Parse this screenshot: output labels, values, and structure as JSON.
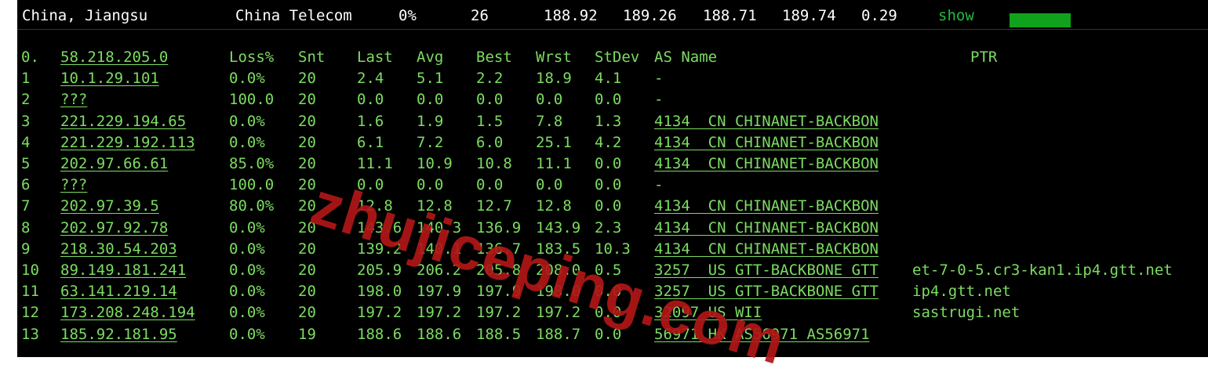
{
  "summary": {
    "location": "China, Jiangsu",
    "isp": "China Telecom",
    "loss": "0%",
    "sent": "26",
    "last": "188.92",
    "avg": "189.26",
    "best": "188.71",
    "worst": "189.74",
    "stdev": "0.29",
    "show_label": "show",
    "colors": {
      "show_link": "#1fbd3c",
      "bar": "#10a21c"
    }
  },
  "table": {
    "header": {
      "host": "0.",
      "target": "58.218.205.0",
      "loss": "Loss%",
      "snt": "Snt",
      "last": "Last",
      "avg": "Avg",
      "best": "Best",
      "wrst": "Wrst",
      "stdev": "StDev",
      "asname": "AS Name",
      "ptr": "PTR"
    },
    "rows": [
      {
        "hop": "1",
        "ip": "10.1.29.101",
        "loss": "0.0%",
        "snt": "20",
        "last": "2.4",
        "avg": "5.1",
        "best": "2.2",
        "wrst": "18.9",
        "stdev": "4.1",
        "as": "-",
        "ptr": ""
      },
      {
        "hop": "2",
        "ip": "???",
        "loss": "100.0",
        "snt": "20",
        "last": "0.0",
        "avg": "0.0",
        "best": "0.0",
        "wrst": "0.0",
        "stdev": "0.0",
        "as": "-",
        "ptr": ""
      },
      {
        "hop": "3",
        "ip": "221.229.194.65",
        "loss": "0.0%",
        "snt": "20",
        "last": "1.6",
        "avg": "1.9",
        "best": "1.5",
        "wrst": "7.8",
        "stdev": "1.3",
        "as": "4134  CN CHINANET-BACKBON",
        "ptr": ""
      },
      {
        "hop": "4",
        "ip": "221.229.192.113",
        "loss": "0.0%",
        "snt": "20",
        "last": "6.1",
        "avg": "7.2",
        "best": "6.0",
        "wrst": "25.1",
        "stdev": "4.2",
        "as": "4134  CN CHINANET-BACKBON",
        "ptr": ""
      },
      {
        "hop": "5",
        "ip": "202.97.66.61",
        "loss": "85.0%",
        "snt": "20",
        "last": "11.1",
        "avg": "10.9",
        "best": "10.8",
        "wrst": "11.1",
        "stdev": "0.0",
        "as": "4134  CN CHINANET-BACKBON",
        "ptr": ""
      },
      {
        "hop": "6",
        "ip": "???",
        "loss": "100.0",
        "snt": "20",
        "last": "0.0",
        "avg": "0.0",
        "best": "0.0",
        "wrst": "0.0",
        "stdev": "0.0",
        "as": "-",
        "ptr": ""
      },
      {
        "hop": "7",
        "ip": "202.97.39.5",
        "loss": "80.0%",
        "snt": "20",
        "last": "12.8",
        "avg": "12.8",
        "best": "12.7",
        "wrst": "12.8",
        "stdev": "0.0",
        "as": "4134  CN CHINANET-BACKBON",
        "ptr": ""
      },
      {
        "hop": "8",
        "ip": "202.97.92.78",
        "loss": "0.0%",
        "snt": "20",
        "last": "143.6",
        "avg": "140.3",
        "best": "136.9",
        "wrst": "143.9",
        "stdev": "2.3",
        "as": "4134  CN CHINANET-BACKBON",
        "ptr": ""
      },
      {
        "hop": "9",
        "ip": "218.30.54.203",
        "loss": "0.0%",
        "snt": "20",
        "last": "139.2",
        "avg": "140.1",
        "best": "136.7",
        "wrst": "183.5",
        "stdev": "10.3",
        "as": "4134  CN CHINANET-BACKBON",
        "ptr": ""
      },
      {
        "hop": "10",
        "ip": "89.149.181.241",
        "loss": "0.0%",
        "snt": "20",
        "last": "205.9",
        "avg": "206.2",
        "best": "205.8",
        "wrst": "208.0",
        "stdev": "0.5",
        "as": "3257  US GTT-BACKBONE GTT",
        "ptr": "et-7-0-5.cr3-kan1.ip4.gtt.net"
      },
      {
        "hop": "11",
        "ip": "63.141.219.14",
        "loss": "0.0%",
        "snt": "20",
        "last": "198.0",
        "avg": "197.9",
        "best": "197.9",
        "wrst": "198.0",
        "stdev": "0.0",
        "as": "3257  US GTT-BACKBONE GTT",
        "ptr": "ip4.gtt.net"
      },
      {
        "hop": "12",
        "ip": "173.208.248.194",
        "loss": "0.0%",
        "snt": "20",
        "last": "197.2",
        "avg": "197.2",
        "best": "197.2",
        "wrst": "197.2",
        "stdev": "0.0",
        "as": "32097 US WII",
        "ptr": "sastrugi.net"
      },
      {
        "hop": "13",
        "ip": "185.92.181.95",
        "loss": "0.0%",
        "snt": "19",
        "last": "188.6",
        "avg": "188.6",
        "best": "188.5",
        "wrst": "188.7",
        "stdev": "0.0",
        "as": "56971 HK AS56971 AS56971",
        "ptr": ""
      }
    ]
  },
  "watermark": {
    "text": "zhujiceping.com",
    "color": "#b01717"
  },
  "colors": {
    "terminal_text": "#7cdc61",
    "background": "#000000",
    "summary_text": "#ffffff"
  }
}
